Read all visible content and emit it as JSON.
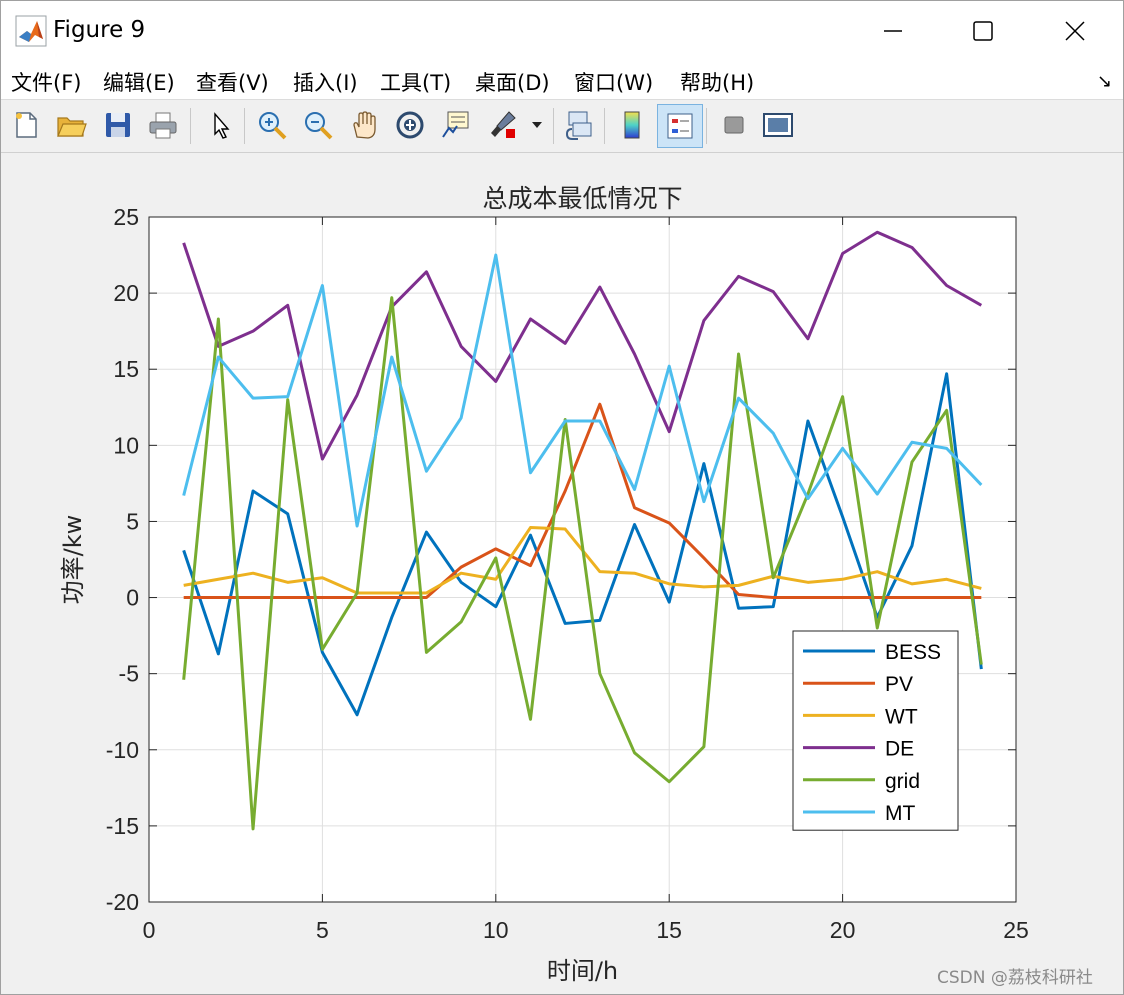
{
  "window": {
    "title": "Figure 9",
    "buttons": {
      "minimize": "minimize-icon",
      "maximize": "maximize-icon",
      "close": "close-icon"
    }
  },
  "menu": {
    "items": [
      "文件(F)",
      "编辑(E)",
      "查看(V)",
      "插入(I)",
      "工具(T)",
      "桌面(D)",
      "窗口(W)",
      "帮助(H)"
    ]
  },
  "toolbar": {
    "icons": [
      "new-figure-icon",
      "open-file-icon",
      "save-icon",
      "print-icon",
      "pointer-icon",
      "zoom-in-icon",
      "zoom-out-icon",
      "pan-hand-icon",
      "rotate-3d-icon",
      "data-cursor-icon",
      "brush-icon",
      "link-plot-icon",
      "colorbar-icon",
      "legend-icon",
      "hide-plot-tools-icon",
      "show-plot-tools-icon"
    ]
  },
  "colors": {
    "BESS": "#0072BD",
    "PV": "#D95319",
    "WT": "#EDB120",
    "DE": "#7E2F8E",
    "grid": "#77AC30",
    "MT": "#4DBEEE"
  },
  "chart_data": {
    "type": "line",
    "title": "总成本最低情况下",
    "xlabel": "时间/h",
    "ylabel": "功率/kw",
    "xlim": [
      0,
      25
    ],
    "ylim": [
      -20,
      25
    ],
    "xticks": [
      "0",
      "5",
      "10",
      "15",
      "20",
      "25"
    ],
    "yticks": [
      "-20",
      "-15",
      "-10",
      "-5",
      "0",
      "5",
      "10",
      "15",
      "20",
      "25"
    ],
    "grid": true,
    "legend_position": "lower-right",
    "x": [
      1,
      2,
      3,
      4,
      5,
      6,
      7,
      8,
      9,
      10,
      11,
      12,
      13,
      14,
      15,
      16,
      17,
      18,
      19,
      20,
      21,
      22,
      23,
      24
    ],
    "series": [
      {
        "name": "BESS",
        "values": [
          3.1,
          -3.7,
          7.0,
          5.5,
          -3.6,
          -7.7,
          -1.3,
          4.3,
          1.0,
          -0.6,
          4.1,
          -1.7,
          -1.5,
          4.8,
          -0.3,
          8.8,
          -0.7,
          -0.6,
          11.6,
          5.3,
          -1.3,
          3.4,
          14.7,
          -4.7
        ]
      },
      {
        "name": "PV",
        "values": [
          0,
          0,
          0,
          0,
          0,
          0,
          0,
          0,
          2.0,
          3.2,
          2.1,
          7.0,
          12.7,
          5.9,
          4.9,
          2.6,
          0.2,
          0,
          0,
          0,
          0,
          0,
          0,
          0
        ]
      },
      {
        "name": "WT",
        "values": [
          0.8,
          1.2,
          1.6,
          1.0,
          1.3,
          0.3,
          0.3,
          0.3,
          1.6,
          1.2,
          4.6,
          4.5,
          1.7,
          1.6,
          0.9,
          0.7,
          0.8,
          1.4,
          1.0,
          1.2,
          1.7,
          0.9,
          1.2,
          0.6
        ]
      },
      {
        "name": "DE",
        "values": [
          23.3,
          16.5,
          17.5,
          19.2,
          9.1,
          13.3,
          19.1,
          21.4,
          16.5,
          14.2,
          18.3,
          16.7,
          20.4,
          16.0,
          10.9,
          18.2,
          21.1,
          20.1,
          17.0,
          22.6,
          24.0,
          23.0,
          20.5,
          19.2
        ]
      },
      {
        "name": "grid",
        "values": [
          -5.4,
          18.3,
          -15.2,
          13.0,
          -3.4,
          0.3,
          19.7,
          -3.6,
          -1.6,
          2.6,
          -8.0,
          11.7,
          -5.0,
          -10.2,
          -12.1,
          -9.8,
          16.0,
          1.3,
          6.8,
          13.2,
          -2.0,
          8.9,
          12.3,
          -4.4
        ]
      },
      {
        "name": "MT",
        "values": [
          6.7,
          15.8,
          13.1,
          13.2,
          20.5,
          4.7,
          15.8,
          8.3,
          11.8,
          22.5,
          8.2,
          11.6,
          11.6,
          7.1,
          15.2,
          6.3,
          13.1,
          10.8,
          6.5,
          9.8,
          6.8,
          10.2,
          9.8,
          7.4
        ]
      }
    ]
  },
  "watermark": "CSDN @荔枝科研社"
}
